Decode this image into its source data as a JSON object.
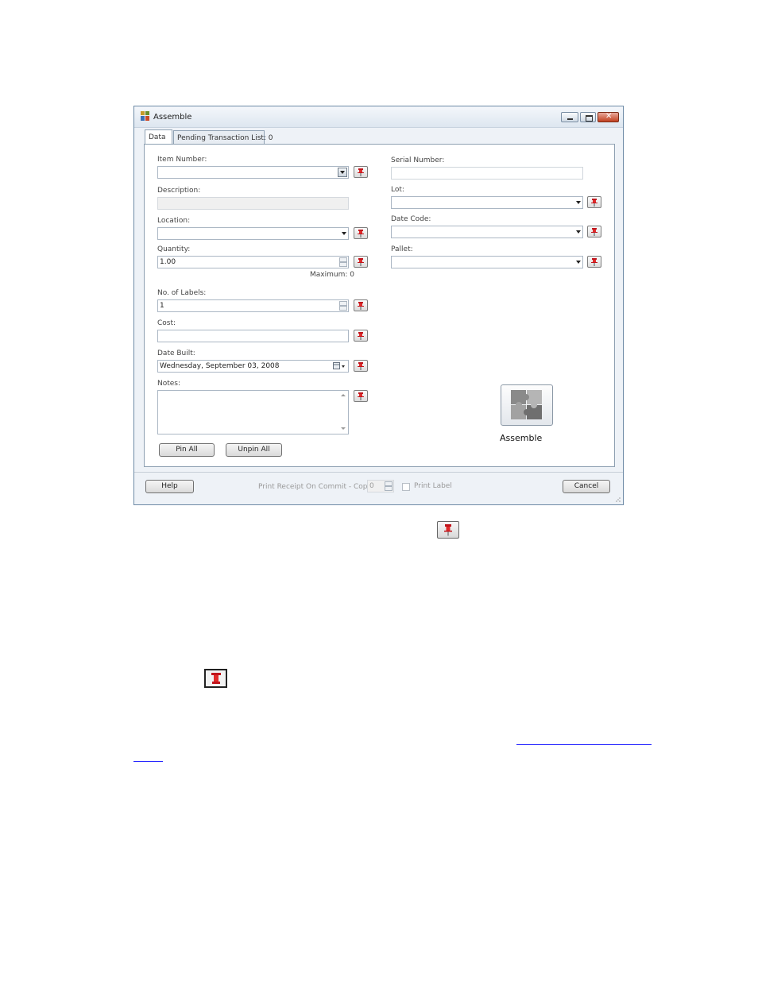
{
  "window": {
    "title": "Assemble",
    "icon": "assemble-app-icon"
  },
  "tabs": [
    {
      "label": "Data",
      "active": true
    },
    {
      "label": "Pending Transaction List: 0",
      "active": false
    }
  ],
  "left": {
    "item_number": {
      "label": "Item Number:",
      "value": ""
    },
    "description": {
      "label": "Description:",
      "value": ""
    },
    "location": {
      "label": "Location:",
      "value": ""
    },
    "quantity": {
      "label": "Quantity:",
      "value": "1.00",
      "maximum": "Maximum: 0"
    },
    "labels": {
      "label": "No. of Labels:",
      "value": "1"
    },
    "cost": {
      "label": "Cost:",
      "value": ""
    },
    "date_built": {
      "label": "Date Built:",
      "value": "Wednesday, September 03, 2008"
    },
    "notes": {
      "label": "Notes:",
      "value": ""
    },
    "pin_all": "Pin All",
    "unpin_all": "Unpin All"
  },
  "right": {
    "serial_number": {
      "label": "Serial Number:",
      "value": ""
    },
    "lot": {
      "label": "Lot:",
      "value": ""
    },
    "date_code": {
      "label": "Date Code:",
      "value": ""
    },
    "pallet": {
      "label": "Pallet:",
      "value": ""
    },
    "assemble_label": "Assemble"
  },
  "footer": {
    "help": "Help",
    "print_receipt": "Print Receipt On Commit - Copies:",
    "copies": "0",
    "print_label": "Print Label",
    "cancel": "Cancel"
  },
  "icons": [
    "pin-icon",
    "puzzle-icon",
    "spin-up-icon",
    "spin-down-icon",
    "calendar-icon",
    "dropdown-arrow-icon"
  ]
}
